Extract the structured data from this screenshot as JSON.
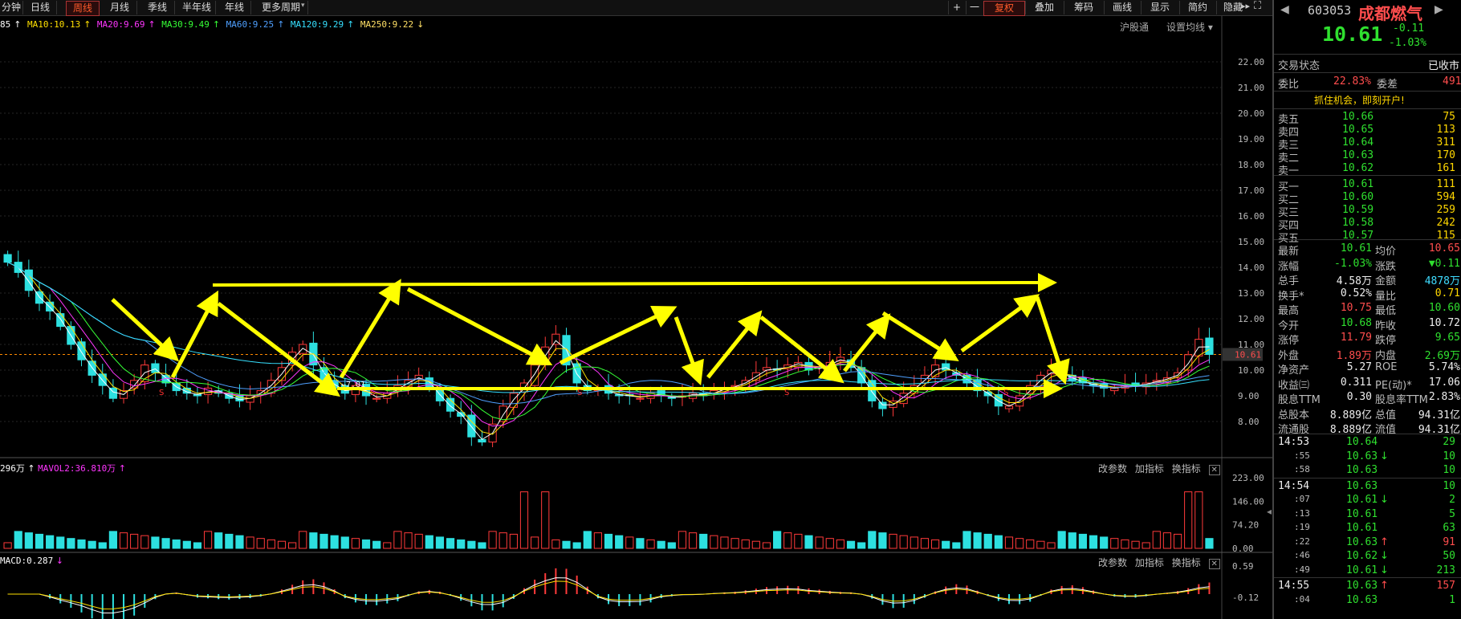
{
  "toolbar": {
    "period_tabs": [
      "分钟",
      "日线",
      "周线",
      "月线",
      "季线",
      "半年线",
      "年线",
      "更多周期"
    ],
    "active_tab": "周线",
    "right_buttons": [
      "+",
      "一",
      "复权",
      "叠加",
      "筹码",
      "画线",
      "显示",
      "简约",
      "隐藏"
    ]
  },
  "ma_legend": [
    {
      "text": "85",
      "color": "#ffffff"
    },
    {
      "text": "MA10:10.13",
      "color": "#ffe000"
    },
    {
      "text": "MA20:9.69",
      "color": "#ff36ff"
    },
    {
      "text": "MA30:9.49",
      "color": "#36ff36"
    },
    {
      "text": "MA60:9.25",
      "color": "#4fa0ff"
    },
    {
      "text": "MA120:9.29",
      "color": "#36e0ff"
    },
    {
      "text": "MA250:9.22",
      "color": "#ffe066"
    }
  ],
  "header_links": {
    "hgt": "沪股通",
    "ma_settings": "设置均线"
  },
  "vol_legend": {
    "v1": "296万",
    "v2": "MAVOL2:36.810万"
  },
  "macd_legend": {
    "text": "MACD:0.287"
  },
  "panel_buttons": {
    "change_params": "改参数",
    "add_indicator": "加指标",
    "swap_indicator": "换指标"
  },
  "chart_data": {
    "type": "candlestick",
    "price_axis": {
      "ticks": [
        "22.00",
        "21.00",
        "20.00",
        "19.00",
        "18.00",
        "17.00",
        "16.00",
        "15.00",
        "14.00",
        "13.00",
        "12.00",
        "11.00",
        "10.00",
        "9.00",
        "8.00"
      ],
      "current": "10.61"
    },
    "low_annotation": "7.01",
    "markers": [
      "S",
      "S",
      "S",
      "S",
      "S"
    ],
    "volume_axis": [
      "223.00",
      "146.00",
      "74.20",
      "0.00"
    ],
    "macd_axis": [
      "0.59",
      "-0.12"
    ],
    "price_series": [
      14.2,
      13.8,
      13.1,
      12.6,
      12.3,
      11.7,
      11.0,
      10.4,
      9.8,
      9.4,
      8.9,
      9.2,
      9.6,
      10.2,
      9.9,
      9.5,
      9.2,
      9.1,
      9.0,
      9.3,
      9.1,
      8.9,
      8.8,
      9.0,
      9.2,
      9.6,
      10.1,
      10.7,
      11.0,
      10.2,
      9.6,
      9.3,
      9.1,
      9.4,
      9.0,
      8.9,
      9.1,
      9.4,
      9.6,
      9.8,
      9.3,
      8.8,
      8.4,
      8.2,
      7.4,
      7.2,
      7.9,
      8.6,
      9.1,
      9.5,
      10.2,
      10.9,
      11.4,
      10.2,
      9.5,
      9.2,
      9.3,
      9.1,
      9.0,
      9.0,
      8.9,
      9.1,
      9.0,
      8.9,
      9.0,
      9.1,
      9.0,
      9.2,
      9.3,
      9.4,
      9.6,
      9.9,
      10.1,
      10.0,
      10.2,
      10.3,
      10.0,
      10.1,
      10.3,
      10.5,
      10.1,
      9.5,
      8.8,
      8.5,
      8.8,
      9.1,
      9.4,
      9.8,
      10.2,
      10.0,
      9.8,
      9.5,
      9.2,
      9.0,
      8.6,
      8.6,
      9.0,
      9.4,
      9.8,
      10.0,
      9.8,
      9.6,
      9.5,
      9.4,
      9.3,
      9.3,
      9.4,
      9.4,
      9.5,
      9.6,
      9.7,
      9.9,
      10.6,
      11.2,
      10.61
    ]
  },
  "quote": {
    "code": "603053",
    "name": "成都燃气",
    "price": "10.61",
    "change": "-0.11",
    "change_pct": "-1.03%",
    "status_label": "交易状态",
    "status_value": "已收市",
    "weibi_label": "委比",
    "weibi_value": "22.83%",
    "weicha_label": "委差",
    "weicha_value": "491",
    "promo": "抓住机会，即刻开户!",
    "asks": [
      {
        "label": "卖五",
        "price": "10.66",
        "vol": "75"
      },
      {
        "label": "卖四",
        "price": "10.65",
        "vol": "113"
      },
      {
        "label": "卖三",
        "price": "10.64",
        "vol": "311"
      },
      {
        "label": "卖二",
        "price": "10.63",
        "vol": "170"
      },
      {
        "label": "卖一",
        "price": "10.62",
        "vol": "161"
      }
    ],
    "bids": [
      {
        "label": "买一",
        "price": "10.61",
        "vol": "111"
      },
      {
        "label": "买二",
        "price": "10.60",
        "vol": "594"
      },
      {
        "label": "买三",
        "price": "10.59",
        "vol": "259"
      },
      {
        "label": "买四",
        "price": "10.58",
        "vol": "242"
      },
      {
        "label": "买五",
        "price": "10.57",
        "vol": "115"
      }
    ],
    "stats": [
      {
        "l1": "最新",
        "v1": "10.61",
        "c1": "dn",
        "l2": "均价",
        "v2": "10.65",
        "c2": "up"
      },
      {
        "l1": "涨幅",
        "v1": "-1.03%",
        "c1": "dn",
        "l2": "涨跌",
        "v2": "▼0.11",
        "c2": "dn"
      },
      {
        "l1": "总手",
        "v1": "4.58万",
        "c1": "wht",
        "l2": "金额",
        "v2": "4878万",
        "c2": "cyan"
      },
      {
        "l1": "换手*",
        "v1": "0.52%",
        "c1": "wht",
        "l2": "量比",
        "v2": "0.71",
        "c2": "yel"
      },
      {
        "l1": "最高",
        "v1": "10.75",
        "c1": "up",
        "l2": "最低",
        "v2": "10.60",
        "c2": "dn"
      },
      {
        "l1": "今开",
        "v1": "10.68",
        "c1": "dn",
        "l2": "昨收",
        "v2": "10.72",
        "c2": "wht"
      },
      {
        "l1": "涨停",
        "v1": "11.79",
        "c1": "up",
        "l2": "跌停",
        "v2": "9.65",
        "c2": "dn"
      },
      {
        "l1": "外盘",
        "v1": "1.89万",
        "c1": "up",
        "l2": "内盘",
        "v2": "2.69万",
        "c2": "dn"
      },
      {
        "l1": "净资产",
        "v1": "5.27",
        "c1": "wht",
        "l2": "ROE",
        "v2": "5.74%",
        "c2": "wht"
      },
      {
        "l1": "收益㈢",
        "v1": "0.311",
        "c1": "wht",
        "l2": "PE(动)*",
        "v2": "17.06",
        "c2": "wht"
      },
      {
        "l1": "股息TTM",
        "v1": "0.30",
        "c1": "wht",
        "l2": "股息率TTM",
        "v2": "2.83%",
        "c2": "wht"
      },
      {
        "l1": "总股本",
        "v1": "8.889亿",
        "c1": "wht",
        "l2": "总值",
        "v2": "94.31亿",
        "c2": "wht"
      },
      {
        "l1": "流通股",
        "v1": "8.889亿",
        "c1": "wht",
        "l2": "流值",
        "v2": "94.31亿",
        "c2": "wht"
      }
    ],
    "ticks": [
      {
        "time": "14:53",
        "price": "10.64",
        "arrow": "",
        "vol": "29",
        "c": "dn",
        "vc": "dn"
      },
      {
        "time": ":55",
        "price": "10.63",
        "arrow": "↓",
        "vol": "10",
        "c": "dn",
        "vc": "dn"
      },
      {
        "time": ":58",
        "price": "10.63",
        "arrow": "",
        "vol": "10",
        "c": "dn",
        "vc": "dn"
      },
      {
        "time": "14:54",
        "price": "10.63",
        "arrow": "",
        "vol": "10",
        "c": "dn",
        "vc": "dn"
      },
      {
        "time": ":07",
        "price": "10.61",
        "arrow": "↓",
        "vol": "2",
        "c": "dn",
        "vc": "dn"
      },
      {
        "time": ":13",
        "price": "10.61",
        "arrow": "",
        "vol": "5",
        "c": "dn",
        "vc": "dn"
      },
      {
        "time": ":19",
        "price": "10.61",
        "arrow": "",
        "vol": "63",
        "c": "dn",
        "vc": "dn"
      },
      {
        "time": ":22",
        "price": "10.63",
        "arrow": "↑",
        "vol": "91",
        "c": "dn",
        "vc": "up"
      },
      {
        "time": ":46",
        "price": "10.62",
        "arrow": "↓",
        "vol": "50",
        "c": "dn",
        "vc": "dn"
      },
      {
        "time": ":49",
        "price": "10.61",
        "arrow": "↓",
        "vol": "213",
        "c": "dn",
        "vc": "dn"
      },
      {
        "time": "14:55",
        "price": "10.63",
        "arrow": "↑",
        "vol": "157",
        "c": "dn",
        "vc": "up"
      },
      {
        "time": ":04",
        "price": "10.63",
        "arrow": "",
        "vol": "1",
        "c": "dn",
        "vc": "dn"
      }
    ]
  }
}
